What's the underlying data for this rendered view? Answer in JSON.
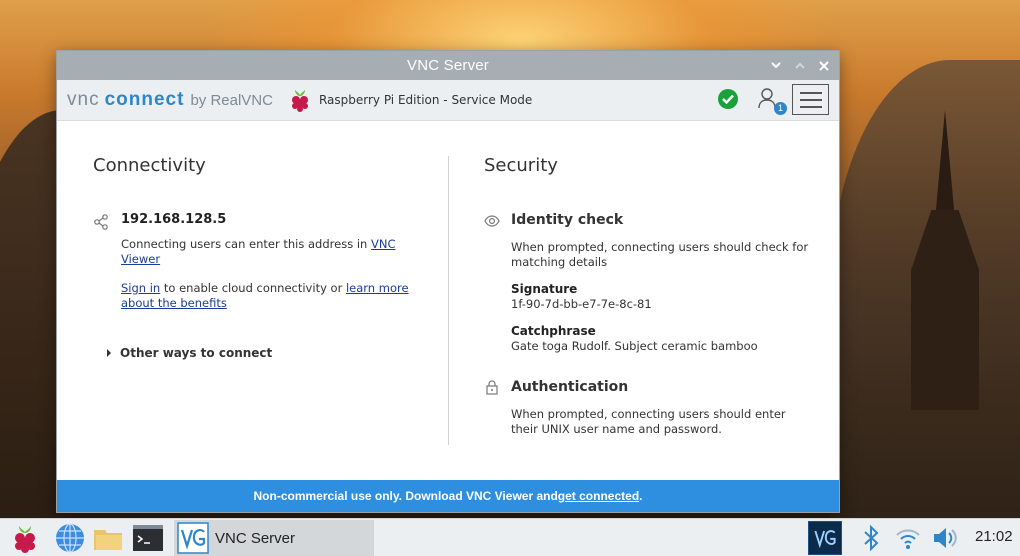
{
  "window": {
    "title": "VNC Server",
    "controls": [
      "minimize",
      "maximize",
      "close"
    ]
  },
  "appbar": {
    "logo_vnc": "vnc",
    "logo_connect": "connect",
    "logo_by": "by RealVNC",
    "edition": "Raspberry Pi Edition - Service Mode",
    "users_count": "1",
    "status_color": "#1aa23a"
  },
  "connectivity": {
    "title": "Connectivity",
    "ip": "192.168.128.5",
    "enter_address_text": "Connecting users can enter this address in ",
    "vnc_viewer_link": "VNC Viewer",
    "sign_in_link": "Sign in",
    "cloud_text": " to enable cloud connectivity or ",
    "learn_more_link": "learn more about the benefits",
    "other_ways": "Other ways to connect"
  },
  "security": {
    "title": "Security",
    "identity_heading": "Identity check",
    "identity_text": "When prompted, connecting users should check for matching details",
    "signature_label": "Signature",
    "signature_value": "1f-90-7d-bb-e7-7e-8c-81",
    "catchphrase_label": "Catchphrase",
    "catchphrase_value": "Gate toga Rudolf. Subject ceramic bamboo",
    "auth_heading": "Authentication",
    "auth_text": "When prompted, connecting users should enter their UNIX user name and password."
  },
  "banner": {
    "text": "Non-commercial use only. Download VNC Viewer and ",
    "link": "get connected",
    "suffix": "."
  },
  "taskbar": {
    "task_label": "VNC Server",
    "clock": "21:02",
    "accent_color": "#2e8fe0"
  }
}
